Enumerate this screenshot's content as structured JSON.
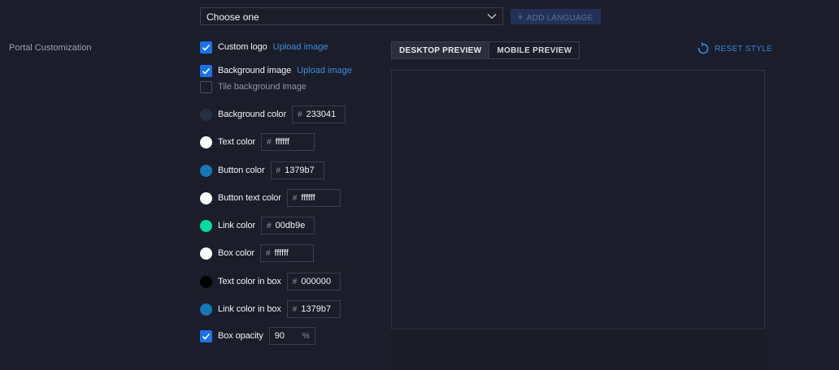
{
  "language": {
    "selected": "Choose one",
    "add_label": "ADD LANGUAGE"
  },
  "section": {
    "label": "Portal Customization"
  },
  "options": {
    "custom_logo": {
      "label": "Custom logo",
      "checked": true,
      "link": "Upload image"
    },
    "background_image": {
      "label": "Background image",
      "checked": true,
      "link": "Upload image"
    },
    "tile_background": {
      "label": "Tile background image",
      "checked": false
    }
  },
  "colors": [
    {
      "label": "Background color",
      "hex": "233041",
      "swatch": "#233041"
    },
    {
      "label": "Text color",
      "hex": "ffffff",
      "swatch": "#ffffff"
    },
    {
      "label": "Button color",
      "hex": "1379b7",
      "swatch": "#1379b7"
    },
    {
      "label": "Button text color",
      "hex": "ffffff",
      "swatch": "#ffffff"
    },
    {
      "label": "Link color",
      "hex": "00db9e",
      "swatch": "#00db9e"
    },
    {
      "label": "Box color",
      "hex": "ffffff",
      "swatch": "#ffffff"
    },
    {
      "label": "Text color in box",
      "hex": "000000",
      "swatch": "#000000"
    },
    {
      "label": "Link color in box",
      "hex": "1379b7",
      "swatch": "#1379b7"
    }
  ],
  "hash_symbol": "#",
  "opacity": {
    "label": "Box opacity",
    "value": "90",
    "unit": "%",
    "checked": true
  },
  "preview": {
    "tabs": [
      {
        "label": "DESKTOP PREVIEW",
        "active": true
      },
      {
        "label": "MOBILE PREVIEW",
        "active": false
      }
    ],
    "reset_label": "RESET STYLE"
  },
  "theme": {
    "accent": "#1a73e8",
    "link": "#3a8dde",
    "background": "#1c1d2a"
  }
}
